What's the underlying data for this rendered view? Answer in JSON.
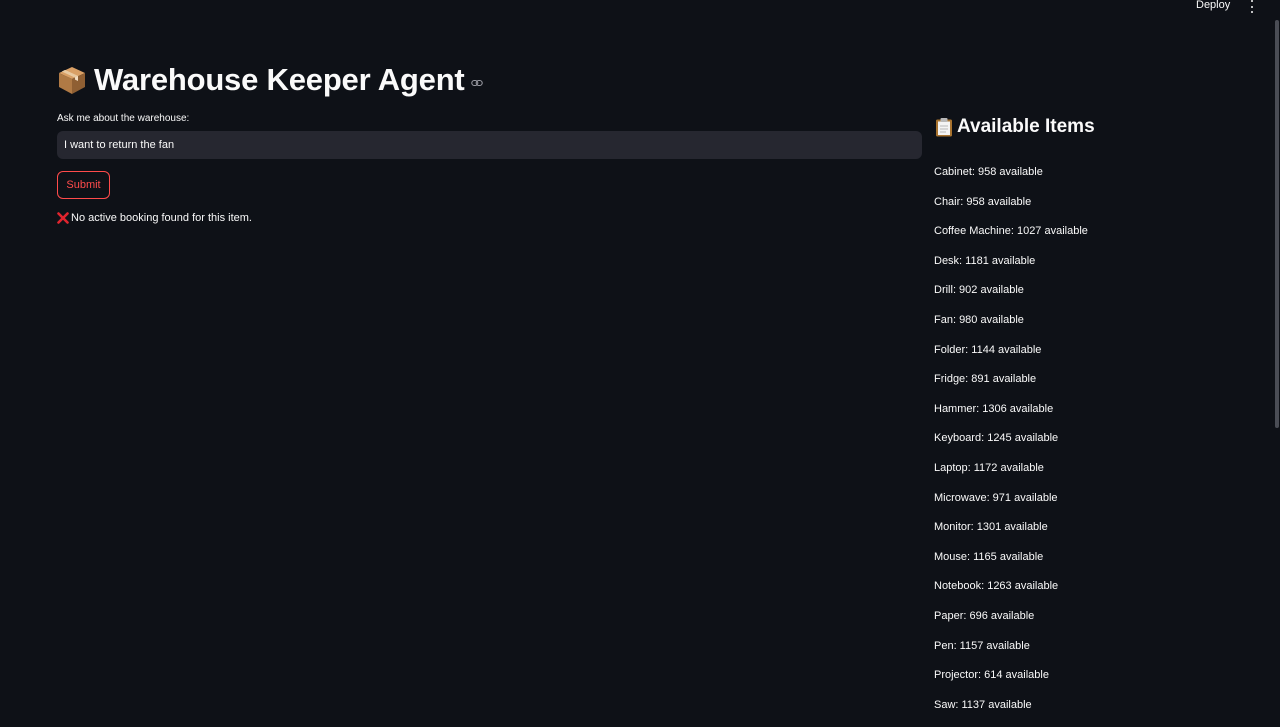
{
  "topbar": {
    "deploy_label": "Deploy",
    "menu_icon": "kebab-menu-icon"
  },
  "main": {
    "title": "Warehouse Keeper Agent",
    "title_icon": "package-box-emoji",
    "link_icon": "link-icon",
    "input_label": "Ask me about the warehouse:",
    "input_value": "I want to return the fan",
    "submit_label": "Submit",
    "error_icon": "cross-mark-icon",
    "error_text": "No active booking found for this item."
  },
  "sidebar": {
    "heading": "Available Items",
    "heading_icon": "clipboard-emoji",
    "items": [
      {
        "text": "Cabinet: 958 available"
      },
      {
        "text": "Chair: 958 available"
      },
      {
        "text": "Coffee Machine: 1027 available"
      },
      {
        "text": "Desk: 1181 available"
      },
      {
        "text": "Drill: 902 available"
      },
      {
        "text": "Fan: 980 available"
      },
      {
        "text": "Folder: 1144 available"
      },
      {
        "text": "Fridge: 891 available"
      },
      {
        "text": "Hammer: 1306 available"
      },
      {
        "text": "Keyboard: 1245 available"
      },
      {
        "text": "Laptop: 1172 available"
      },
      {
        "text": "Microwave: 971 available"
      },
      {
        "text": "Monitor: 1301 available"
      },
      {
        "text": "Mouse: 1165 available"
      },
      {
        "text": "Notebook: 1263 available"
      },
      {
        "text": "Paper: 696 available"
      },
      {
        "text": "Pen: 1157 available"
      },
      {
        "text": "Projector: 614 available"
      },
      {
        "text": "Saw: 1137 available"
      }
    ]
  },
  "colors": {
    "background": "#0e1117",
    "text": "#fafafa",
    "input_bg": "#262730",
    "accent": "#ff4b4b"
  }
}
